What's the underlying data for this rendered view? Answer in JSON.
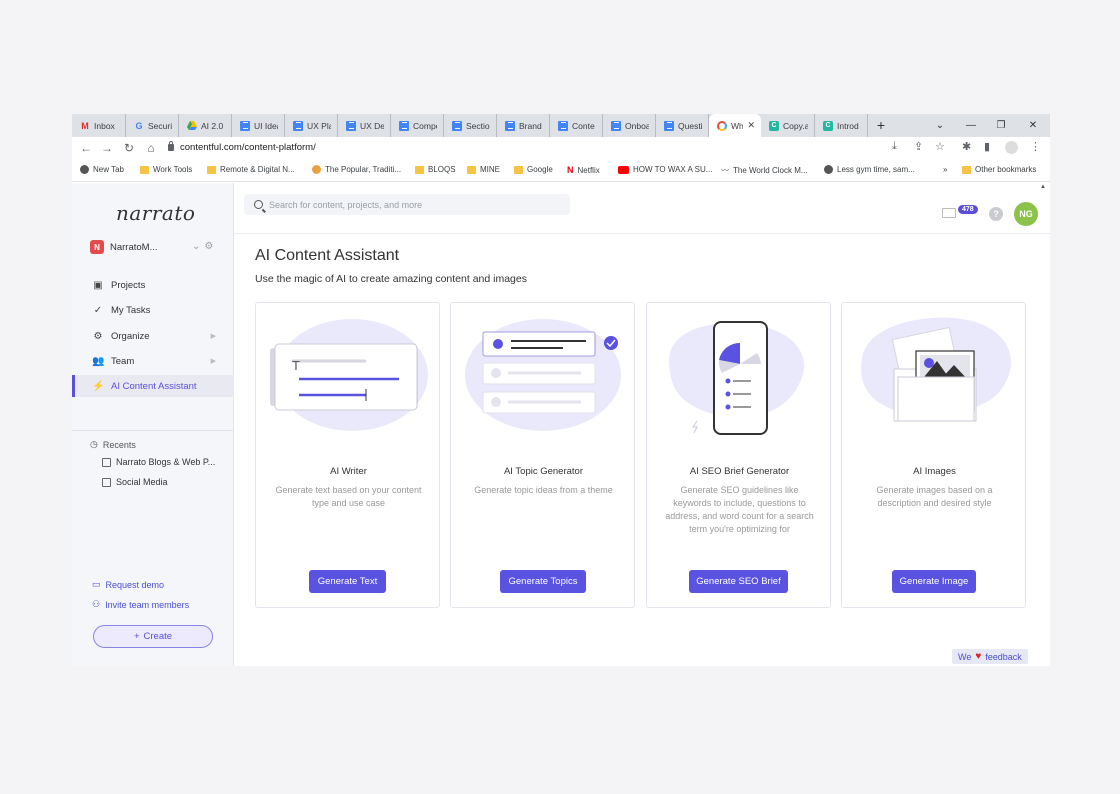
{
  "browser": {
    "tabs": [
      {
        "label": "Inbox",
        "icon": "gmail-icon"
      },
      {
        "label": "Securit",
        "icon": "google-icon"
      },
      {
        "label": "AI 2.0",
        "icon": "drive-icon"
      },
      {
        "label": "UI Idea",
        "icon": "docs-icon"
      },
      {
        "label": "UX Pla",
        "icon": "docs-icon"
      },
      {
        "label": "UX Del",
        "icon": "docs-icon"
      },
      {
        "label": "Compe",
        "icon": "docs-icon"
      },
      {
        "label": "Sectio",
        "icon": "docs-icon"
      },
      {
        "label": "Brand",
        "icon": "docs-icon"
      },
      {
        "label": "Conte",
        "icon": "docs-icon"
      },
      {
        "label": "Onboa",
        "icon": "docs-icon"
      },
      {
        "label": "Questi",
        "icon": "docs-icon"
      },
      {
        "label": "Wh",
        "icon": "contentful-icon"
      },
      {
        "label": "Copy.a",
        "icon": "copyai-icon"
      },
      {
        "label": "Introd",
        "icon": "copyai-icon"
      }
    ],
    "new_tab_symbol": "+",
    "url": "contentful.com/content-platform/",
    "bookmarks": [
      {
        "label": "New Tab"
      },
      {
        "label": "Work Tools"
      },
      {
        "label": "Remote & Digital N..."
      },
      {
        "label": "The Popular, Traditi..."
      },
      {
        "label": "BLOQS"
      },
      {
        "label": "MINE"
      },
      {
        "label": "Google"
      },
      {
        "label": "Netflix"
      },
      {
        "label": "HOW TO WAX A SU..."
      },
      {
        "label": "The World Clock M..."
      },
      {
        "label": "Less gym time, sam..."
      }
    ],
    "bookmarks_overflow": "»",
    "other_bookmarks": "Other bookmarks"
  },
  "app": {
    "logo": "narrato",
    "workspace": {
      "badge": "N",
      "name": "NarratoM..."
    },
    "nav": [
      {
        "label": "Projects",
        "icon": "briefcase-icon"
      },
      {
        "label": "My Tasks",
        "icon": "checklist-icon"
      },
      {
        "label": "Organize",
        "icon": "gears-icon"
      },
      {
        "label": "Team",
        "icon": "team-icon"
      },
      {
        "label": "AI Content Assistant",
        "icon": "bolt-icon"
      }
    ],
    "recents_label": "Recents",
    "recents": [
      "Narrato Blogs & Web P...",
      "Social Media"
    ],
    "request_demo": "Request demo",
    "invite": "Invite team members",
    "create": "Create",
    "search_placeholder": "Search for content, projects, and more",
    "mail_count": "478",
    "help": "?",
    "avatar": "NG",
    "page_title": "AI Content Assistant",
    "page_subtitle": "Use the magic of AI to create amazing content and images",
    "cards": [
      {
        "title": "AI Writer",
        "desc": "Generate text based on your content type and use case",
        "button": "Generate Text"
      },
      {
        "title": "AI Topic Generator",
        "desc": "Generate topic ideas from a theme",
        "button": "Generate Topics"
      },
      {
        "title": "AI SEO Brief Generator",
        "desc": "Generate SEO guidelines like keywords to include, questions to address, and word count for a search term you're optimizing for",
        "button": "Generate SEO Brief"
      },
      {
        "title": "AI Images",
        "desc": "Generate images based on a description and desired style",
        "button": "Generate Image"
      }
    ],
    "feedback": {
      "pre": "We",
      "post": "feedback"
    },
    "accent_color": "#5a52e0",
    "blob_color": "#e9e9fb"
  }
}
